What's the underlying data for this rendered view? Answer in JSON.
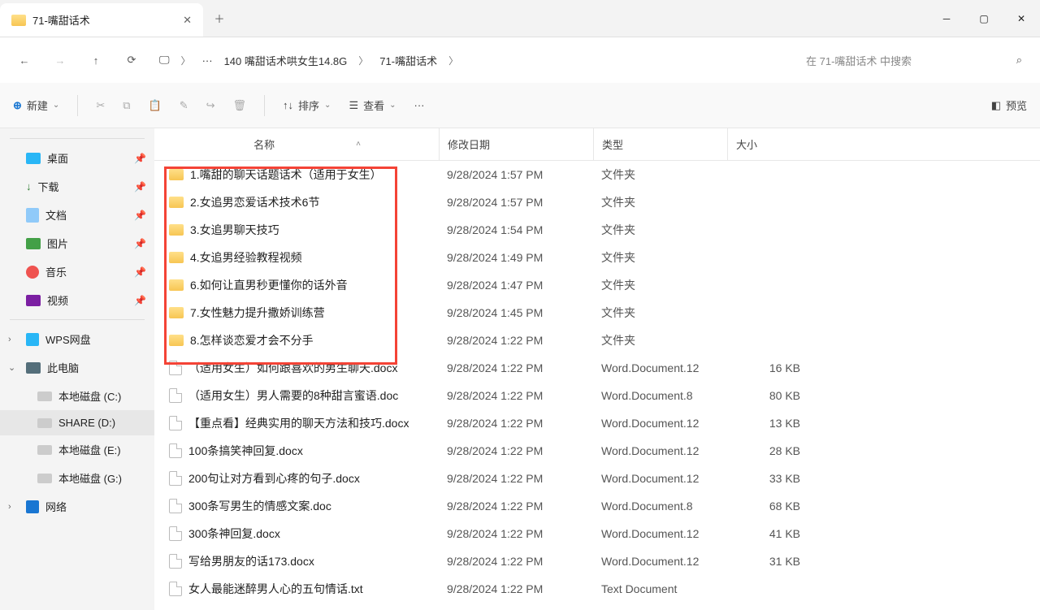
{
  "window": {
    "title": "71-嘴甜话术"
  },
  "breadcrumb": {
    "dots": "···",
    "p1": "140  嘴甜话术哄女生14.8G",
    "p2": "71-嘴甜话术"
  },
  "search": {
    "placeholder": "在 71-嘴甜话术 中搜索"
  },
  "toolbar": {
    "new": "新建",
    "sort": "排序",
    "view": "查看",
    "preview": "预览"
  },
  "columns": {
    "name": "名称",
    "date": "修改日期",
    "type": "类型",
    "size": "大小"
  },
  "sidebar": {
    "quick": [
      {
        "label": "桌面"
      },
      {
        "label": "下载"
      },
      {
        "label": "文档"
      },
      {
        "label": "图片"
      },
      {
        "label": "音乐"
      },
      {
        "label": "视频"
      }
    ],
    "wps": "WPS网盘",
    "pc": "此电脑",
    "drives": [
      {
        "label": "本地磁盘 (C:)"
      },
      {
        "label": "SHARE (D:)"
      },
      {
        "label": "本地磁盘 (E:)"
      },
      {
        "label": "本地磁盘 (G:)"
      }
    ],
    "network": "网络"
  },
  "rows": [
    {
      "name": "1.嘴甜的聊天话题话术（适用于女生）",
      "date": "9/28/2024 1:57 PM",
      "type": "文件夹",
      "size": "",
      "icon": "folder"
    },
    {
      "name": "2.女追男恋爱话术技术6节",
      "date": "9/28/2024 1:57 PM",
      "type": "文件夹",
      "size": "",
      "icon": "folder"
    },
    {
      "name": "3.女追男聊天技巧",
      "date": "9/28/2024 1:54 PM",
      "type": "文件夹",
      "size": "",
      "icon": "folder"
    },
    {
      "name": "4.女追男经验教程视频",
      "date": "9/28/2024 1:49 PM",
      "type": "文件夹",
      "size": "",
      "icon": "folder"
    },
    {
      "name": "6.如何让直男秒更懂你的话外音",
      "date": "9/28/2024 1:47 PM",
      "type": "文件夹",
      "size": "",
      "icon": "folder"
    },
    {
      "name": "7.女性魅力提升撒娇训练营",
      "date": "9/28/2024 1:45 PM",
      "type": "文件夹",
      "size": "",
      "icon": "folder"
    },
    {
      "name": "8.怎样谈恋爱才会不分手",
      "date": "9/28/2024 1:22 PM",
      "type": "文件夹",
      "size": "",
      "icon": "folder"
    },
    {
      "name": "（适用女生）如何跟喜欢的男生聊天.docx",
      "date": "9/28/2024 1:22 PM",
      "type": "Word.Document.12",
      "size": "16 KB",
      "icon": "doc"
    },
    {
      "name": "（适用女生）男人需要的8种甜言蜜语.doc",
      "date": "9/28/2024 1:22 PM",
      "type": "Word.Document.8",
      "size": "80 KB",
      "icon": "doc"
    },
    {
      "name": "【重点看】经典实用的聊天方法和技巧.docx",
      "date": "9/28/2024 1:22 PM",
      "type": "Word.Document.12",
      "size": "13 KB",
      "icon": "doc"
    },
    {
      "name": "100条搞笑神回复.docx",
      "date": "9/28/2024 1:22 PM",
      "type": "Word.Document.12",
      "size": "28 KB",
      "icon": "doc"
    },
    {
      "name": "200句让对方看到心疼的句子.docx",
      "date": "9/28/2024 1:22 PM",
      "type": "Word.Document.12",
      "size": "33 KB",
      "icon": "doc"
    },
    {
      "name": "300条写男生的情感文案.doc",
      "date": "9/28/2024 1:22 PM",
      "type": "Word.Document.8",
      "size": "68 KB",
      "icon": "doc"
    },
    {
      "name": "300条神回复.docx",
      "date": "9/28/2024 1:22 PM",
      "type": "Word.Document.12",
      "size": "41 KB",
      "icon": "doc"
    },
    {
      "name": "写给男朋友的话173.docx",
      "date": "9/28/2024 1:22 PM",
      "type": "Word.Document.12",
      "size": "31 KB",
      "icon": "doc"
    },
    {
      "name": "女人最能迷醉男人心的五句情话.txt",
      "date": "9/28/2024 1:22 PM",
      "type": "Text Document",
      "size": "",
      "icon": "doc"
    }
  ]
}
